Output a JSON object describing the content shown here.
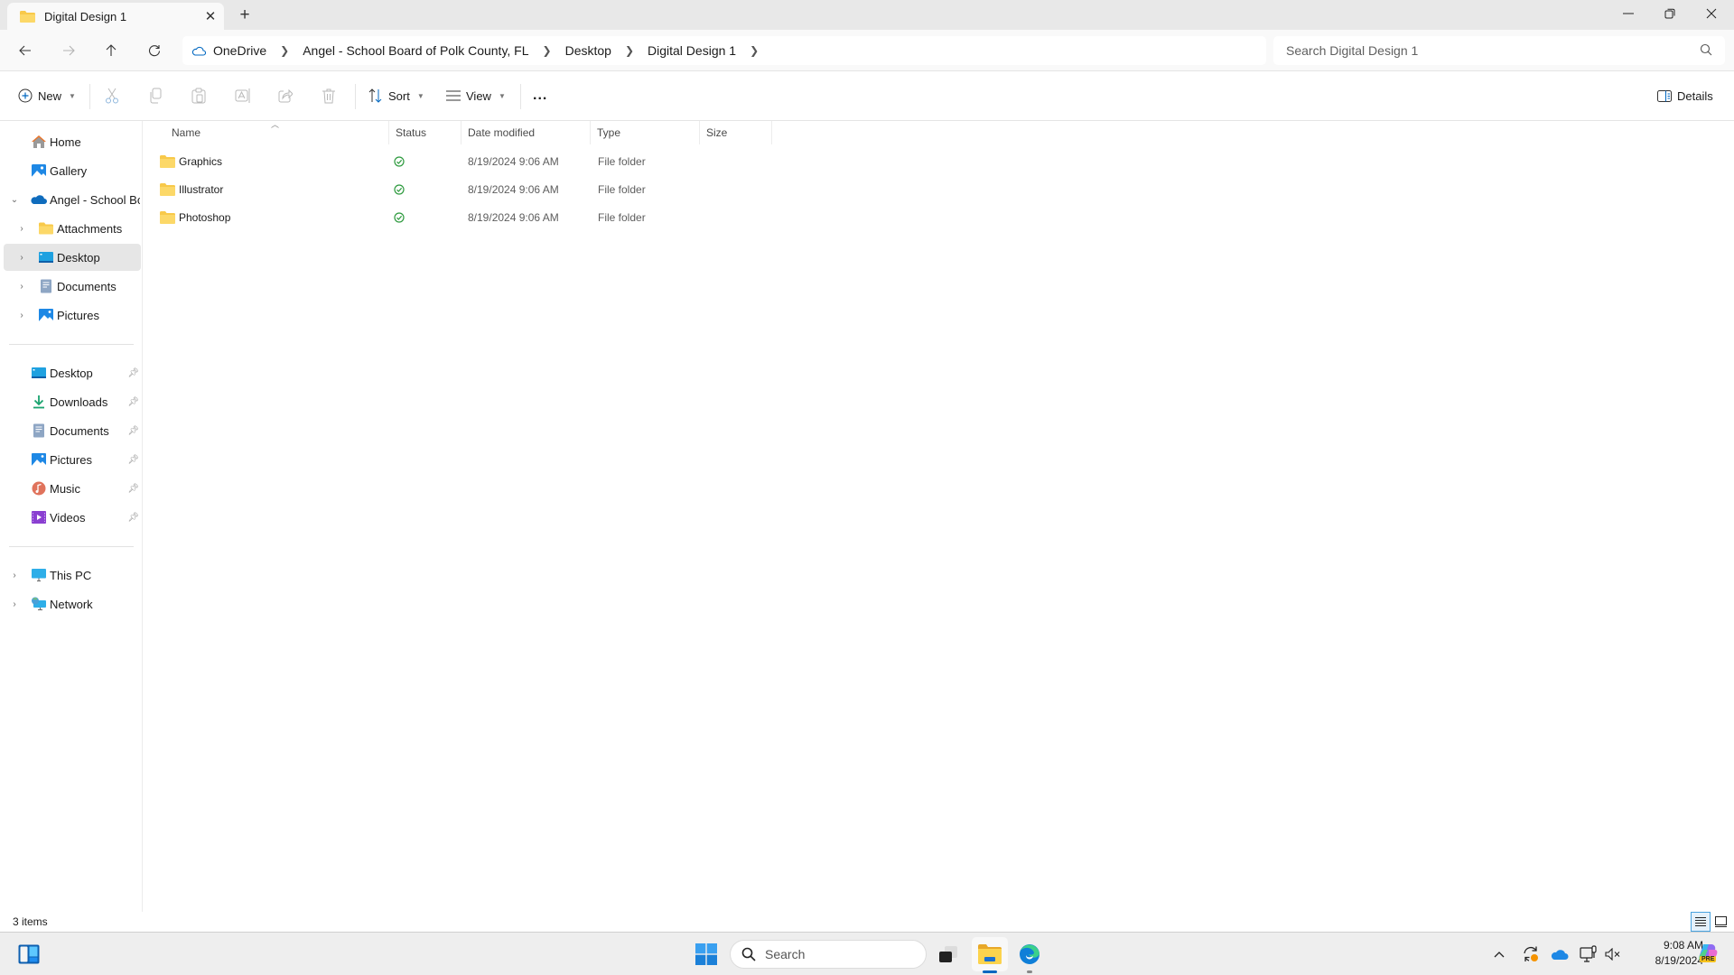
{
  "window": {
    "tab_title": "Digital Design 1",
    "new_tab_label": "+",
    "controls": {
      "minimize": "minimize",
      "maximize": "restore",
      "close": "close"
    }
  },
  "nav": {
    "back": "back",
    "forward": "forward",
    "up": "up",
    "refresh": "refresh",
    "breadcrumb": [
      "OneDrive",
      "Angel - School Board of Polk County, FL",
      "Desktop",
      "Digital Design 1"
    ],
    "search_placeholder": "Search Digital Design 1"
  },
  "toolbar": {
    "new_label": "New",
    "cut": "cut",
    "copy": "copy",
    "paste": "paste",
    "rename": "rename",
    "share": "share",
    "delete": "delete",
    "sort_label": "Sort",
    "view_label": "View",
    "more_label": "...",
    "details_label": "Details"
  },
  "sidebar": {
    "top": [
      {
        "label": "Home",
        "icon": "home-icon"
      },
      {
        "label": "Gallery",
        "icon": "gallery-icon"
      },
      {
        "label": "Angel - School Boa",
        "icon": "onedrive-icon",
        "expanded": true
      },
      {
        "label": "Attachments",
        "icon": "folder-icon"
      },
      {
        "label": "Desktop",
        "icon": "desktop-icon",
        "selected": true
      },
      {
        "label": "Documents",
        "icon": "documents-icon"
      },
      {
        "label": "Pictures",
        "icon": "pictures-icon"
      }
    ],
    "quick_access": [
      {
        "label": "Desktop",
        "icon": "desktop-icon"
      },
      {
        "label": "Downloads",
        "icon": "downloads-icon"
      },
      {
        "label": "Documents",
        "icon": "documents-icon"
      },
      {
        "label": "Pictures",
        "icon": "pictures-icon"
      },
      {
        "label": "Music",
        "icon": "music-icon"
      },
      {
        "label": "Videos",
        "icon": "videos-icon"
      }
    ],
    "bottom": [
      {
        "label": "This PC",
        "icon": "this-pc-icon"
      },
      {
        "label": "Network",
        "icon": "network-icon"
      }
    ]
  },
  "files": {
    "columns": [
      "Name",
      "Status",
      "Date modified",
      "Type",
      "Size"
    ],
    "rows": [
      {
        "name": "Graphics",
        "status": "synced",
        "date": "8/19/2024 9:06 AM",
        "type": "File folder",
        "size": ""
      },
      {
        "name": "Illustrator",
        "status": "synced",
        "date": "8/19/2024 9:06 AM",
        "type": "File folder",
        "size": ""
      },
      {
        "name": "Photoshop",
        "status": "synced",
        "date": "8/19/2024 9:06 AM",
        "type": "File folder",
        "size": ""
      }
    ]
  },
  "status_bar": {
    "item_count": "3 items"
  },
  "taskbar": {
    "search_label": "Search",
    "time": "9:08 AM",
    "date": "8/19/2024",
    "copilot_badge": "PRE"
  },
  "colors": {
    "accent": "#0067c0",
    "folder": "#f8c94a",
    "sync_ok": "#2d9a3e",
    "selected_bg": "#e6e6e6"
  }
}
